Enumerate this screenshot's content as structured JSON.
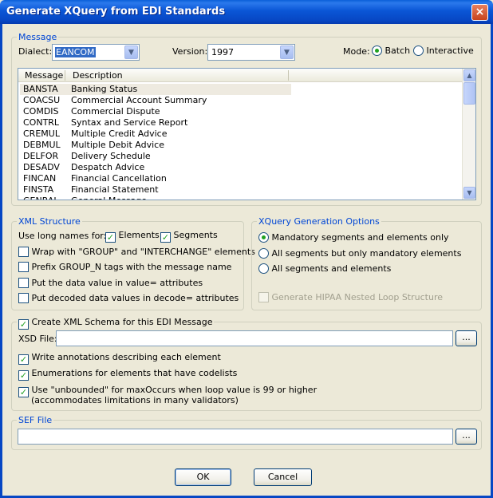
{
  "window": {
    "title": "Generate XQuery from EDI Standards",
    "close_glyph": "×"
  },
  "message_group": {
    "legend": "Message",
    "dialect_label": "Dialect:",
    "dialect_value": "EANCOM",
    "version_label": "Version:",
    "version_value": "1997",
    "mode_label": "Mode:",
    "mode_batch": "Batch",
    "mode_interactive": "Interactive",
    "list": {
      "col_message": "Message",
      "col_description": "Description",
      "rows": [
        {
          "code": "BANSTA",
          "desc": "Banking Status"
        },
        {
          "code": "COACSU",
          "desc": "Commercial Account Summary"
        },
        {
          "code": "COMDIS",
          "desc": "Commercial Dispute"
        },
        {
          "code": "CONTRL",
          "desc": "Syntax and Service Report"
        },
        {
          "code": "CREMUL",
          "desc": "Multiple Credit Advice"
        },
        {
          "code": "DEBMUL",
          "desc": "Multiple Debit Advice"
        },
        {
          "code": "DELFOR",
          "desc": "Delivery Schedule"
        },
        {
          "code": "DESADV",
          "desc": "Despatch Advice"
        },
        {
          "code": "FINCAN",
          "desc": "Financial Cancellation"
        },
        {
          "code": "FINSTA",
          "desc": "Financial Statement"
        },
        {
          "code": "GENRAL",
          "desc": "General Message"
        }
      ]
    }
  },
  "xml_structure": {
    "legend": "XML Structure",
    "long_names_label": "Use long names for:",
    "elements_label": "Elements",
    "segments_label": "Segments",
    "wrap_label": "Wrap with \"GROUP\" and \"INTERCHANGE\" elements",
    "prefix_label": "Prefix GROUP_N tags with the message name",
    "value_attr_label": "Put the data value in value= attributes",
    "decode_attr_label": "Put decoded data values in decode= attributes"
  },
  "xquery_options": {
    "legend": "XQuery Generation Options",
    "opt_mandatory": "Mandatory segments and elements only",
    "opt_all_segments": "All segments but only mandatory elements",
    "opt_all": "All segments and elements",
    "hipaa_label": "Generate HIPAA Nested Loop Structure"
  },
  "schema": {
    "create_label": "Create XML Schema for this EDI Message",
    "xsd_label": "XSD File:",
    "xsd_value": "",
    "browse_label": "...",
    "annotations_label": "Write annotations describing each element",
    "enumerations_label": "Enumerations for elements that have codelists",
    "unbounded_label": "Use \"unbounded\" for maxOccurs when loop value is 99 or higher",
    "unbounded_note": "(accommodates limitations in many validators)"
  },
  "sef": {
    "legend": "SEF File",
    "value": "",
    "browse_label": "..."
  },
  "buttons": {
    "ok": "OK",
    "cancel": "Cancel"
  }
}
